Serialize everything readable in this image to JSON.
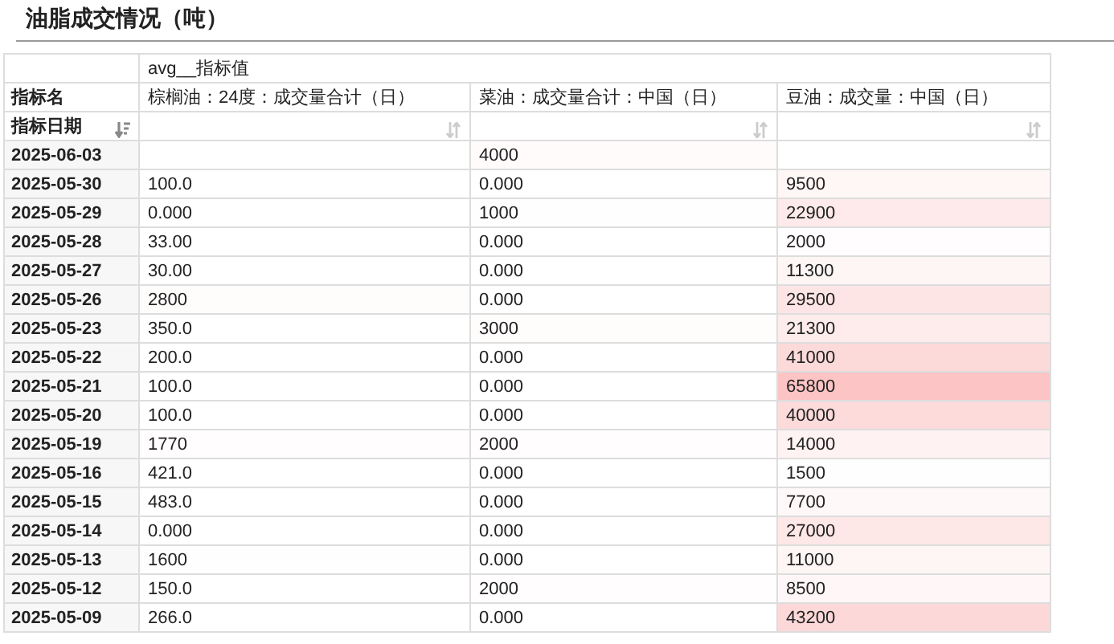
{
  "title": "油脂成交情况（吨）",
  "table": {
    "value_header": "avg__指标值",
    "row_header_name": "指标名",
    "row_header_date": "指标日期",
    "columns": [
      {
        "label": "棕榈油：24度：成交量合计（日）"
      },
      {
        "label": "菜油：成交量合计：中国（日）"
      },
      {
        "label": "豆油：成交量：中国（日）"
      }
    ],
    "rows": [
      {
        "date": "2025-06-03",
        "column_2": "4000"
      },
      {
        "date": "2025-05-30",
        "column_1": "100.0",
        "column_2": "0.000",
        "column_3": "9500"
      },
      {
        "date": "2025-05-29",
        "column_1": "0.000",
        "column_2": "1000",
        "column_3": "22900"
      },
      {
        "date": "2025-05-28",
        "column_1": "33.00",
        "column_2": "0.000",
        "column_3": "2000"
      },
      {
        "date": "2025-05-27",
        "column_1": "30.00",
        "column_2": "0.000",
        "column_3": "11300"
      },
      {
        "date": "2025-05-26",
        "column_1": "2800",
        "column_2": "0.000",
        "column_3": "29500"
      },
      {
        "date": "2025-05-23",
        "column_1": "350.0",
        "column_2": "3000",
        "column_3": "21300"
      },
      {
        "date": "2025-05-22",
        "column_1": "200.0",
        "column_2": "0.000",
        "column_3": "41000"
      },
      {
        "date": "2025-05-21",
        "column_1": "100.0",
        "column_2": "0.000",
        "column_3": "65800"
      },
      {
        "date": "2025-05-20",
        "column_1": "100.0",
        "column_2": "0.000",
        "column_3": "40000"
      },
      {
        "date": "2025-05-19",
        "column_1": "1770",
        "column_2": "2000",
        "column_3": "14000"
      },
      {
        "date": "2025-05-16",
        "column_1": "421.0",
        "column_2": "0.000",
        "column_3": "1500"
      },
      {
        "date": "2025-05-15",
        "column_1": "483.0",
        "column_2": "0.000",
        "column_3": "7700"
      },
      {
        "date": "2025-05-14",
        "column_1": "0.000",
        "column_2": "0.000",
        "column_3": "27000"
      },
      {
        "date": "2025-05-13",
        "column_1": "1600",
        "column_2": "0.000",
        "column_3": "11000"
      },
      {
        "date": "2025-05-12",
        "column_1": "150.0",
        "column_2": "2000",
        "column_3": "8500"
      },
      {
        "date": "2025-05-09",
        "column_1": "266.0",
        "column_2": "0.000",
        "column_3": "43200"
      }
    ]
  }
}
